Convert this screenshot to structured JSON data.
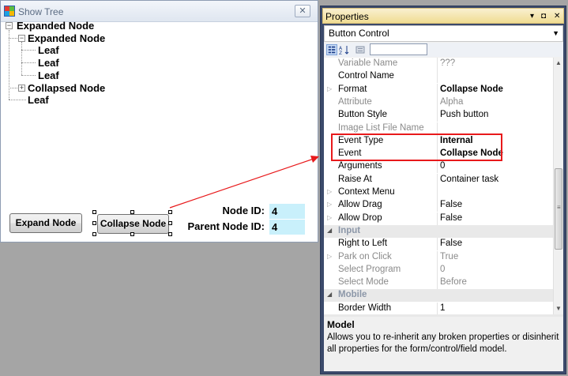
{
  "show_tree": {
    "title": "Show Tree",
    "close_glyph": "✕",
    "tree": [
      {
        "label": "Expanded Node",
        "toggle": "−"
      },
      {
        "label": "Expanded Node",
        "toggle": "−"
      },
      {
        "label": "Leaf"
      },
      {
        "label": "Leaf"
      },
      {
        "label": "Leaf"
      },
      {
        "label": "Collapsed Node",
        "toggle": "+"
      },
      {
        "label": "Leaf"
      }
    ],
    "expand_button": "Expand Node",
    "collapse_button": "Collapse Node",
    "node_id_label": "Node ID:",
    "node_id_value": "4",
    "parent_node_id_label": "Parent Node ID:",
    "parent_node_id_value": "4"
  },
  "properties": {
    "title": "Properties",
    "title_icons": {
      "menu": "▾",
      "pin": "◘",
      "close": "✕"
    },
    "object_selector": "Button Control",
    "object_selector_arrow": "▼",
    "toolbar_icons": [
      "categorized-icon",
      "alphabetical-icon",
      "property-pages-icon"
    ],
    "rows": [
      {
        "name": "Variable Name",
        "value": "???",
        "style": "disabled"
      },
      {
        "name": "Control Name",
        "value": "",
        "style": "normal"
      },
      {
        "name": "Format",
        "value": "Collapse Node",
        "style": "bold",
        "expander": "▷"
      },
      {
        "name": "Attribute",
        "value": "Alpha",
        "style": "disabled"
      },
      {
        "name": "Button Style",
        "value": "Push button",
        "style": "normal"
      },
      {
        "name": "Image List File Name",
        "value": "",
        "style": "disabled"
      },
      {
        "name": "Event Type",
        "value": "Internal",
        "style": "bold"
      },
      {
        "name": "Event",
        "value": "Collapse Node",
        "style": "bold"
      },
      {
        "name": "Arguments",
        "value": "0",
        "style": "normal"
      },
      {
        "name": "Raise At",
        "value": "Container task",
        "style": "normal"
      },
      {
        "name": "Context Menu",
        "value": "",
        "style": "normal",
        "expander": "▷"
      },
      {
        "name": "Allow Drag",
        "value": "False",
        "style": "normal",
        "expander": "▷"
      },
      {
        "name": "Allow Drop",
        "value": "False",
        "style": "normal",
        "expander": "▷"
      },
      {
        "name": "Input",
        "value": "",
        "style": "category",
        "expander": "◢"
      },
      {
        "name": "Right to Left",
        "value": "False",
        "style": "normal"
      },
      {
        "name": "Park on Click",
        "value": "True",
        "style": "disabled",
        "expander": "▷"
      },
      {
        "name": "Select Program",
        "value": "0",
        "style": "disabled"
      },
      {
        "name": "Select Mode",
        "value": "Before",
        "style": "disabled"
      },
      {
        "name": "Mobile",
        "value": "",
        "style": "category",
        "expander": "◢"
      },
      {
        "name": "Border Width",
        "value": "1",
        "style": "normal"
      }
    ],
    "scroll_up": "▲",
    "scroll_down": "▼",
    "scroll_grip": "≡",
    "description_title": "Model",
    "description_text": "Allows you to re-inherit any broken properties or disinherit all properties for the form/control/field model."
  },
  "colors": {
    "highlight": "#e8191b",
    "field_background": "#c9f0fb",
    "properties_frame": "#3b4a6b"
  }
}
